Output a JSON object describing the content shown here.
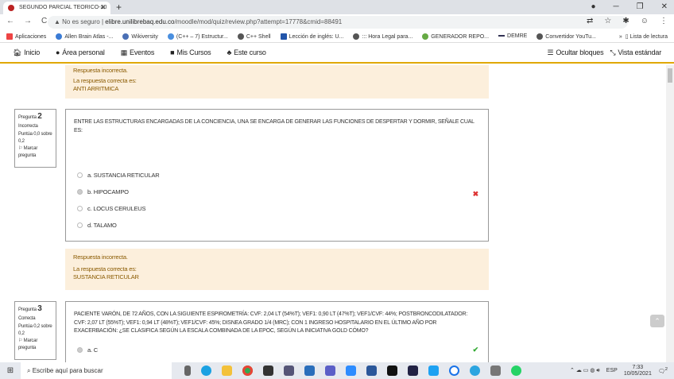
{
  "browser": {
    "tab_title": "SEGUNDO PARCIAL TEORICO-20",
    "security": "No es seguro",
    "url_host": "elibre.unilibrebaq.edu.co",
    "url_path": "/moodle/mod/quiz/review.php?attempt=17778&cmid=88491",
    "bookmarks": [
      "Aplicaciones",
      "Allen Brain Atlas -...",
      "Wikiversity",
      "(C++ – 7) Estructur...",
      "C++ Shell",
      "Lección de inglés: U...",
      "::: Hora Legal para...",
      "GENERADOR REPO...",
      "DEMRE",
      "Convertidor YouTu..."
    ],
    "reading_list": "Lista de lectura"
  },
  "navbar": {
    "items": [
      "Inicio",
      "Área personal",
      "Eventos",
      "Mis Cursos",
      "Este curso"
    ],
    "hide_blocks": "Ocultar bloques",
    "standard_view": "Vista estándar"
  },
  "q1_feedback": {
    "status": "Respuesta incorrecta.",
    "correct_label": "La respuesta correcta es:",
    "correct": "ANTI ARRITMICA"
  },
  "q2": {
    "label": "Pregunta",
    "number": "2",
    "state": "Incorrecta",
    "score": "Puntúa 0,0 sobre 0,2",
    "flag": "Marcar pregunta",
    "text": "ENTRE LAS ESTRUCTURAS ENCARGADAS DE LA CONCIENCIA, UNA SE ENCARGA DE GENERAR LAS FUNCIONES DE DESPERTAR Y DORMIR, SEÑALE CUAL ES:",
    "options": [
      "a. SUSTANCIA RETICULAR",
      "b. HIPOCAMPO",
      "c. LOCUS CERULEUS",
      "d. TALAMO"
    ],
    "selected": 1,
    "feedback": {
      "status": "Respuesta incorrecta.",
      "correct_label": "La respuesta correcta es:",
      "correct": "SUSTANCIA RETICULAR"
    }
  },
  "q3": {
    "label": "Pregunta",
    "number": "3",
    "state": "Correcta",
    "score": "Puntúa 0,2 sobre 0,2",
    "flag": "Marcar pregunta",
    "text": "PACIENTE VARÓN, DE 72 AÑOS, CON LA SIGUIENTE ESPIROMETRÍA: CVF: 2,04 LT (54%T); VEF1: 0,90 LT (47%T); VEF1/CVF: 44%; POSTBRONCODILATADOR: CVF: 2,07 LT (55%T); VEF1: 0,94 LT (48%T); VEF1/CVF: 45%; DISNEA GRADO 1/4 (MRC); CON 1 INGRESO HOSPITALARIO EN EL ÚLTIMO AÑO POR EXACERBACIÓN: ¿SE CLASIFICA SEGÚN LA ESCALA COMBINADA DE LA EPOC, SEGÚN LA INICIATIVA GOLD CÓMO?",
    "options": [
      "a. C"
    ]
  },
  "taskbar": {
    "search_placeholder": "Escribe aquí para buscar",
    "lang": "ESP",
    "time": "7:33",
    "date": "10/05/2021",
    "notif": "2"
  }
}
